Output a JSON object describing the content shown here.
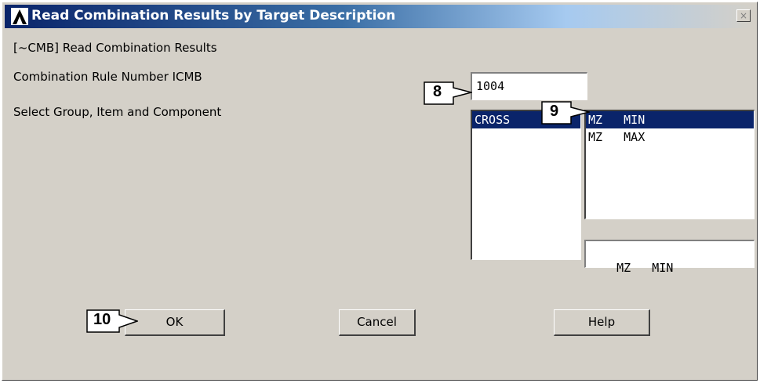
{
  "window": {
    "title": "Read Combination Results by Target Description",
    "close_symbol": "×"
  },
  "labels": {
    "command": "[~CMB] Read Combination Results",
    "rule_number": "Combination Rule Number   ICMB",
    "select": "Select Group, Item and Component"
  },
  "icmb_input": {
    "value": "1004"
  },
  "group_list": {
    "items": [
      "CROSS"
    ],
    "selected": "CROSS"
  },
  "item_list": {
    "items": [
      "MZ   MIN",
      "MZ   MAX"
    ],
    "selected": "MZ   MIN"
  },
  "selection_field": {
    "value": "MZ   MIN"
  },
  "buttons": {
    "ok": "OK",
    "cancel": "Cancel",
    "help": "Help"
  },
  "callouts": {
    "c8": "8",
    "c9": "9",
    "c10": "10"
  },
  "colors": {
    "title_start": "#0a246a",
    "selection": "#0a246a",
    "dialog_bg": "#d4d0c8"
  }
}
